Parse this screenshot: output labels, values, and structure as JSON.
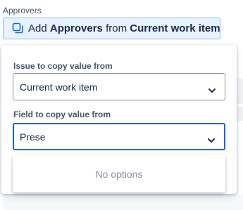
{
  "section": {
    "label": "Approvers"
  },
  "chip": {
    "prefix": "Add",
    "field": "Approvers",
    "connector": "from",
    "source": "Current work item",
    "icon": "copy-icon"
  },
  "popup": {
    "issue_field": {
      "label": "Issue to copy value from",
      "value": "Current work item",
      "icon": "chevron-down-icon"
    },
    "copy_field": {
      "label": "Field to copy value from",
      "input_value": "Prese",
      "icon": "chevron-down-icon"
    },
    "menu": {
      "empty_text": "No options"
    }
  },
  "colors": {
    "accent": "#0c66e4",
    "chip_bg": "#e9f2ff",
    "chip_border": "#85b8ff",
    "text": "#172b4d",
    "subtle_text": "#44546f",
    "muted_text": "#8590a2"
  }
}
